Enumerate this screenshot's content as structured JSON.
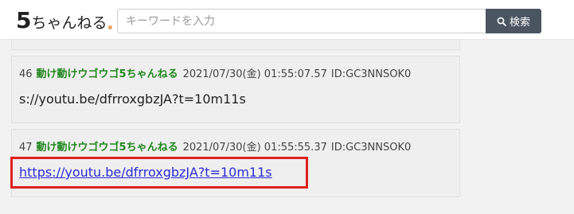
{
  "header": {
    "logo_five": "5",
    "logo_text": "ちゃんねる",
    "search_placeholder": "キーワードを入力",
    "search_button_label": "検索"
  },
  "posts": [
    {
      "number": "46",
      "name": "動け動けウゴウゴ5ちゃんねる",
      "date": "2021/07/30(金) 01:55:07.57",
      "id": "ID:GC3NNSOK0",
      "body": "s://youtu.be/dfrroxgbzJA?t=10m11s"
    },
    {
      "number": "47",
      "name": "動け動けウゴウゴ5ちゃんねる",
      "date": "2021/07/30(金) 01:55:55.37",
      "id": "ID:GC3NNSOK0",
      "link": "https://youtu.be/dfrroxgbzJA?t=10m11s"
    }
  ],
  "colors": {
    "name_green": "#22871f",
    "link_blue": "#2b2bd6",
    "highlight_red": "#e02020",
    "search_button_bg": "#4a5560"
  },
  "icons": {
    "search_button_icon": "search-icon"
  }
}
